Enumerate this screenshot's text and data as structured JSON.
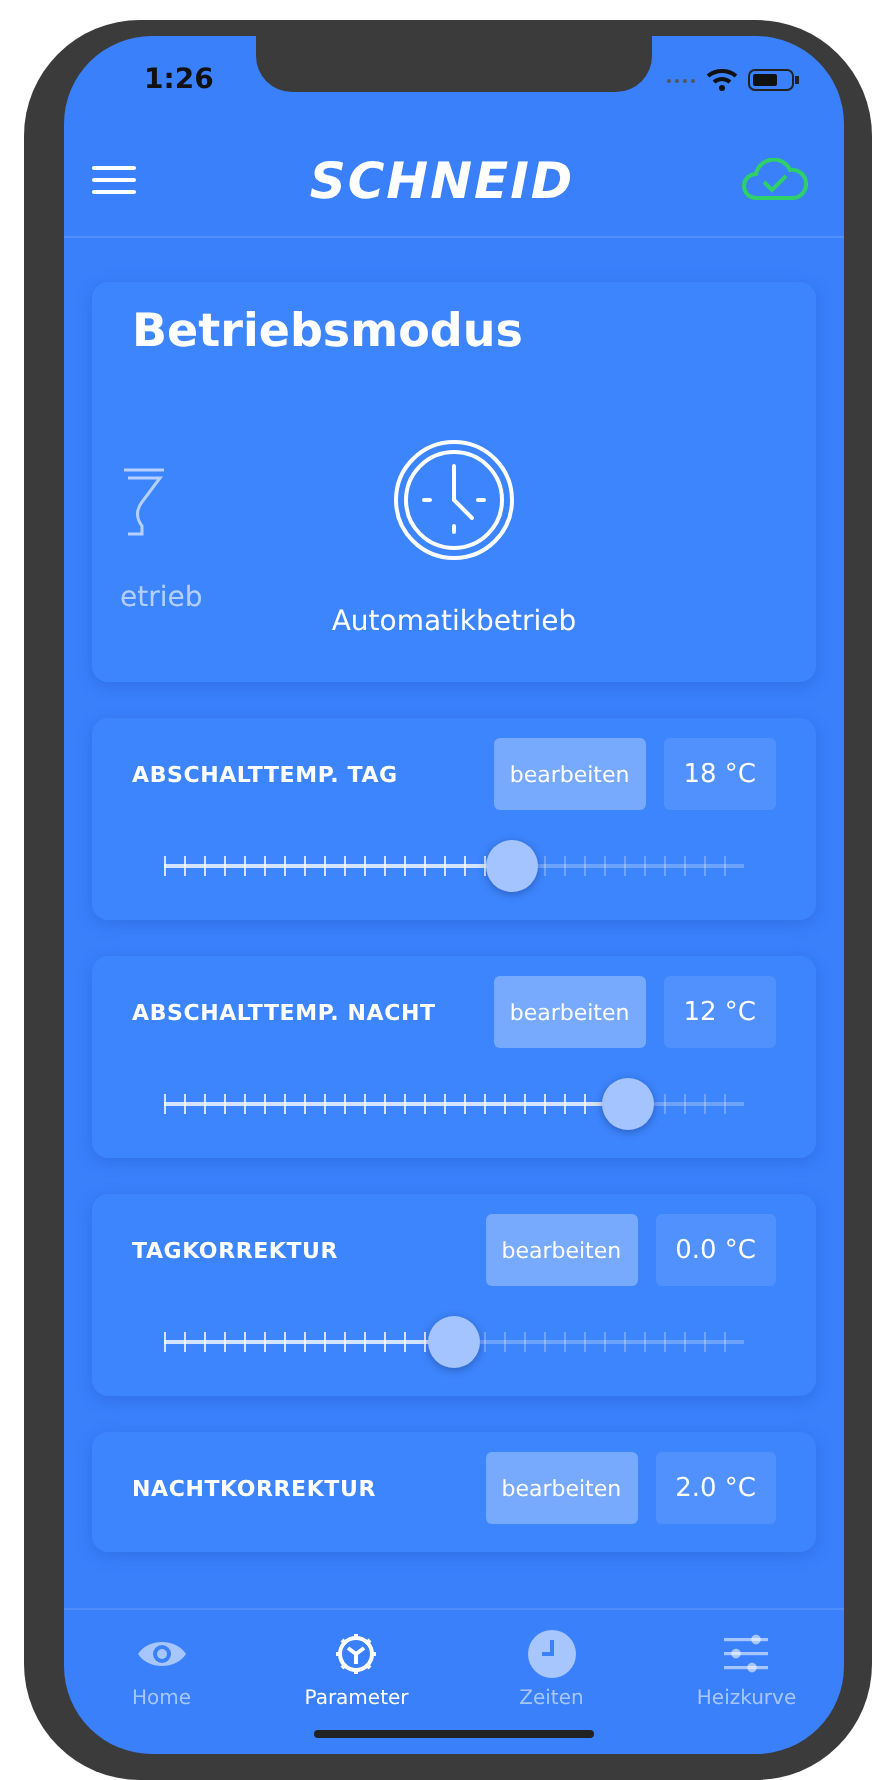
{
  "status_bar": {
    "time": "1:26"
  },
  "header": {
    "logo": "SCHNEID"
  },
  "mode_card": {
    "title": "Betriebsmodus",
    "modes": [
      {
        "kind": "glass",
        "label": "etrieb",
        "selected": false
      },
      {
        "kind": "clock",
        "label": "Automatikbetrieb",
        "selected": true
      }
    ]
  },
  "parameters": [
    {
      "label": "ABSCHALTTEMP. TAG",
      "button": "bearbeiten",
      "value": "18 °C",
      "level": 0.6
    },
    {
      "label": "ABSCHALTTEMP. NACHT",
      "button": "bearbeiten",
      "value": "12 °C",
      "level": 0.8
    },
    {
      "label": "TAGKORREKTUR",
      "button": "bearbeiten",
      "value": "0.0 °C",
      "level": 0.5
    },
    {
      "label": "NACHTKORREKTUR",
      "button": "bearbeiten",
      "value": "2.0 °C"
    }
  ],
  "tabs": [
    {
      "kind": "eye",
      "label": "Home",
      "selected": false
    },
    {
      "kind": "gear",
      "label": "Parameter",
      "selected": true
    },
    {
      "kind": "clock",
      "label": "Zeiten",
      "selected": false
    },
    {
      "kind": "sliders",
      "label": "Heizkurve",
      "selected": false
    }
  ]
}
